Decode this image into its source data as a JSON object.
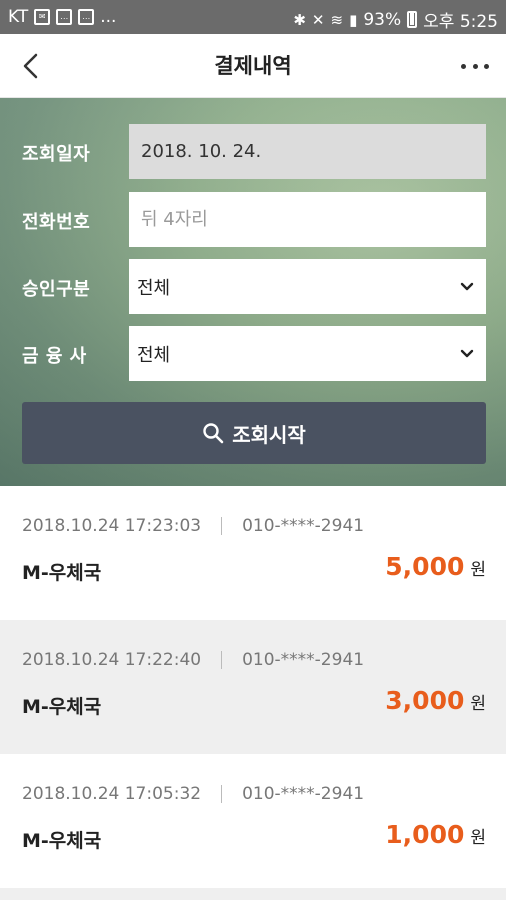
{
  "statusbar": {
    "carrier": "KT",
    "overflow": "...",
    "battery_pct": "93%",
    "time": "오후 5:25"
  },
  "header": {
    "title": "결제내역"
  },
  "form": {
    "date_label": "조회일자",
    "date_value": "2018. 10. 24.",
    "phone_label": "전화번호",
    "phone_placeholder": "뒤 4자리",
    "approval_label": "승인구분",
    "approval_value": "전체",
    "company_label": "금 융 사",
    "company_value": "전체",
    "search_button": "조회시작"
  },
  "transactions": [
    {
      "datetime": "2018.10.24 17:23:03",
      "phone": "010-****-2941",
      "merchant": "M-우체국",
      "amount": "5,000",
      "unit": "원"
    },
    {
      "datetime": "2018.10.24 17:22:40",
      "phone": "010-****-2941",
      "merchant": "M-우체국",
      "amount": "3,000",
      "unit": "원"
    },
    {
      "datetime": "2018.10.24 17:05:32",
      "phone": "010-****-2941",
      "merchant": "M-우체국",
      "amount": "1,000",
      "unit": "원"
    }
  ],
  "colors": {
    "accent_amount": "#e85d1c",
    "button_bg": "#4a5261",
    "statusbar_bg": "#6b6b6b"
  },
  "icons": [
    "back-arrow-icon",
    "more-icon",
    "chevron-down-icon",
    "search-icon"
  ]
}
